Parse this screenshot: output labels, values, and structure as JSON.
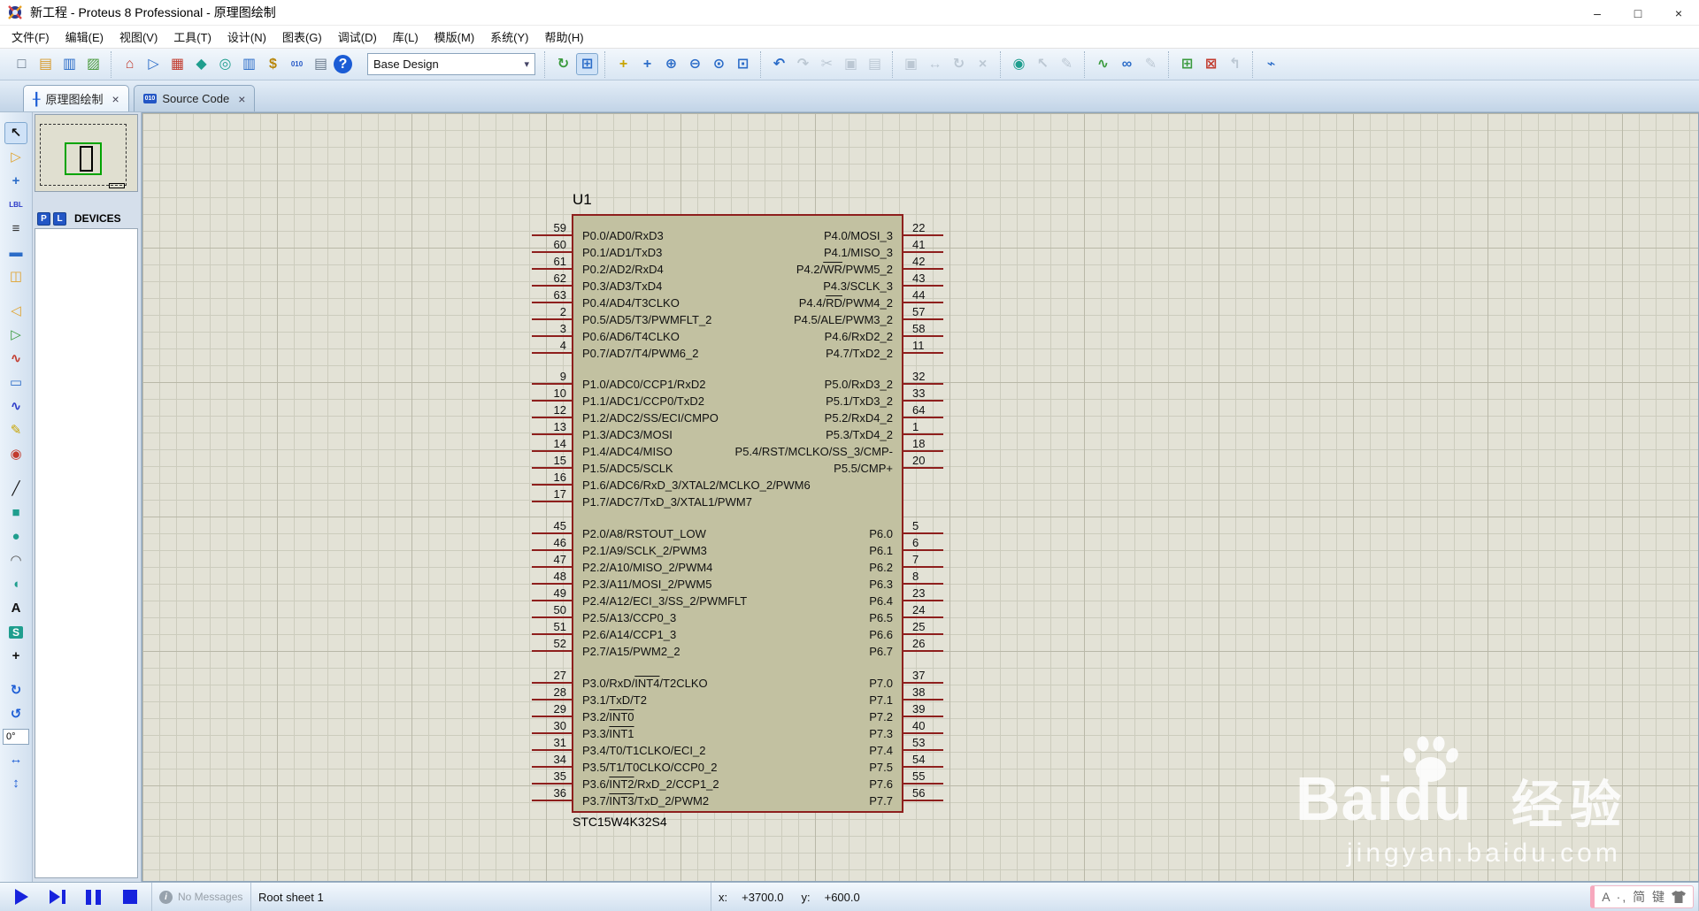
{
  "window": {
    "title": "新工程 - Proteus 8 Professional - 原理图绘制",
    "controls": [
      {
        "name": "minimize-button",
        "glyph": "–"
      },
      {
        "name": "maximize-button",
        "glyph": "□"
      },
      {
        "name": "close-button",
        "glyph": "×"
      }
    ]
  },
  "menu": {
    "items": [
      "文件(F)",
      "编辑(E)",
      "视图(V)",
      "工具(T)",
      "设计(N)",
      "图表(G)",
      "调试(D)",
      "库(L)",
      "模版(M)",
      "系统(Y)",
      "帮助(H)"
    ]
  },
  "toolbar": {
    "design_selector": {
      "value": "Base Design",
      "arrow": "▾"
    },
    "segments": [
      {
        "kind": "icons",
        "items": [
          {
            "n": "new-project-icon",
            "g": "□",
            "c": "#5a6b7d"
          },
          {
            "n": "open-project-icon",
            "g": "▤",
            "c": "#d79a2b"
          },
          {
            "n": "save-project-icon",
            "g": "▥",
            "c": "#2b6cc8"
          },
          {
            "n": "import-project-icon",
            "g": "▨",
            "c": "#4a9a3d"
          }
        ]
      },
      {
        "kind": "icons",
        "items": [
          {
            "n": "home-icon",
            "g": "⌂",
            "c": "#c23b2e"
          },
          {
            "n": "schematic-capture-icon",
            "g": "▷",
            "c": "#2b6cc8"
          },
          {
            "n": "pcb-layout-icon",
            "g": "▦",
            "c": "#c23b2e"
          },
          {
            "n": "3d-visualizer-icon",
            "g": "◆",
            "c": "#1f9e8e"
          },
          {
            "n": "gerber-viewer-icon",
            "g": "◎",
            "c": "#1f9e8e"
          },
          {
            "n": "design-explorer-icon",
            "g": "▥",
            "c": "#2b6cc8"
          },
          {
            "n": "bill-of-materials-icon",
            "g": "$",
            "c": "#b8860b"
          },
          {
            "n": "source-code-icon",
            "g": "010",
            "c": "#2356c5"
          },
          {
            "n": "project-notes-icon",
            "g": "▤",
            "c": "#6b7b8d"
          },
          {
            "n": "help-icon",
            "g": "?",
            "c": "#ffffff",
            "round": true
          }
        ]
      },
      {
        "kind": "select"
      },
      {
        "kind": "icons",
        "items": [
          {
            "n": "redraw-icon",
            "g": "↻",
            "c": "#3a9a3d"
          },
          {
            "n": "grid-toggle-icon",
            "g": "⊞",
            "c": "#2b6cc8",
            "pressed": true
          }
        ]
      },
      {
        "kind": "icons",
        "items": [
          {
            "n": "origin-icon",
            "g": "+",
            "c": "#c8a400"
          },
          {
            "n": "pan-icon",
            "g": "+",
            "c": "#2b6cc8"
          },
          {
            "n": "zoom-in-icon",
            "g": "⊕",
            "c": "#2b6cc8"
          },
          {
            "n": "zoom-out-icon",
            "g": "⊖",
            "c": "#2b6cc8"
          },
          {
            "n": "zoom-all-icon",
            "g": "⊙",
            "c": "#2b6cc8"
          },
          {
            "n": "zoom-area-icon",
            "g": "⊡",
            "c": "#2b6cc8"
          }
        ]
      },
      {
        "kind": "icons",
        "items": [
          {
            "n": "undo-icon",
            "g": "↶",
            "c": "#2b6cc8"
          },
          {
            "n": "redo-icon",
            "g": "↷",
            "c": "#8a99a8",
            "disabled": true
          },
          {
            "n": "cut-icon",
            "g": "✂",
            "c": "#8a99a8",
            "disabled": true
          },
          {
            "n": "copy-icon",
            "g": "▣",
            "c": "#8a99a8",
            "disabled": true
          },
          {
            "n": "paste-icon",
            "g": "▤",
            "c": "#8a99a8",
            "disabled": true
          }
        ]
      },
      {
        "kind": "icons",
        "items": [
          {
            "n": "block-copy-icon",
            "g": "▣",
            "c": "#8a99a8",
            "disabled": true
          },
          {
            "n": "block-move-icon",
            "g": "↔",
            "c": "#8a99a8",
            "disabled": true
          },
          {
            "n": "block-rotate-icon",
            "g": "↻",
            "c": "#8a99a8",
            "disabled": true
          },
          {
            "n": "block-delete-icon",
            "g": "×",
            "c": "#8a99a8",
            "disabled": true
          }
        ]
      },
      {
        "kind": "icons",
        "items": [
          {
            "n": "goto-sheet-icon",
            "g": "◉",
            "c": "#1f9e8e"
          },
          {
            "n": "cursor-add-icon",
            "g": "↖",
            "c": "#8a99a8",
            "disabled": true
          },
          {
            "n": "design-tools-icon",
            "g": "✎",
            "c": "#8a99a8",
            "disabled": true
          }
        ]
      },
      {
        "kind": "icons",
        "items": [
          {
            "n": "wire-autoroute-icon",
            "g": "∿",
            "c": "#3a9a3d"
          },
          {
            "n": "search-icon",
            "g": "∞",
            "c": "#2b6cc8"
          },
          {
            "n": "property-assignment-icon",
            "g": "✎",
            "c": "#8a99a8",
            "disabled": true
          }
        ]
      },
      {
        "kind": "icons",
        "items": [
          {
            "n": "new-sheet-icon",
            "g": "⊞",
            "c": "#3a9a3d"
          },
          {
            "n": "remove-sheet-icon",
            "g": "⊠",
            "c": "#c23b2e"
          },
          {
            "n": "parent-sheet-icon",
            "g": "↰",
            "c": "#8a99a8",
            "disabled": true
          }
        ]
      },
      {
        "kind": "icons",
        "items": [
          {
            "n": "erc-report-icon",
            "g": "⌁",
            "c": "#2b6cc8"
          }
        ]
      }
    ]
  },
  "tabs": [
    {
      "label": "原理图绘制",
      "icon": "schematic-tab-icon",
      "glyph": "╂",
      "close": "×",
      "active": true
    },
    {
      "label": "Source Code",
      "icon": "source-code-tab-icon",
      "glyph": "010",
      "close": "×",
      "active": false
    }
  ],
  "tool_strip": {
    "angle_value": "0°",
    "items": [
      {
        "n": "selection-tool-icon",
        "g": "↖",
        "c": "#111111",
        "selected": true
      },
      {
        "n": "component-mode-icon",
        "g": "▷",
        "c": "#e0a22c"
      },
      {
        "n": "junction-dot-icon",
        "g": "+",
        "c": "#2b6cc8"
      },
      {
        "n": "wire-label-icon",
        "g": "LBL",
        "c": "#2b3ac8"
      },
      {
        "n": "text-script-icon",
        "g": "≡",
        "c": "#333333"
      },
      {
        "n": "bus-icon",
        "g": "▬",
        "c": "#2b6cc8"
      },
      {
        "n": "subcircuit-icon",
        "g": "◫",
        "c": "#e0a22c"
      },
      {
        "kind": "sep"
      },
      {
        "n": "terminal-mode-icon",
        "g": "◁",
        "c": "#e0a22c"
      },
      {
        "n": "device-pin-icon",
        "g": "▷",
        "c": "#3a9a3d"
      },
      {
        "n": "graph-mode-icon",
        "g": "∿",
        "c": "#c23b2e"
      },
      {
        "n": "active-popup-icon",
        "g": "▭",
        "c": "#2b6cc8"
      },
      {
        "n": "generator-mode-icon",
        "g": "∿",
        "c": "#2b3ac8"
      },
      {
        "n": "voltage-probe-icon",
        "g": "✎",
        "c": "#c8a400"
      },
      {
        "n": "virtual-instruments-icon",
        "g": "◉",
        "c": "#c23b2e"
      },
      {
        "kind": "sep"
      },
      {
        "n": "line-2d-icon",
        "g": "╱",
        "c": "#111111"
      },
      {
        "n": "box-2d-icon",
        "g": "■",
        "c": "#1f9e8e"
      },
      {
        "n": "circle-2d-icon",
        "g": "●",
        "c": "#1f9e8e"
      },
      {
        "n": "arc-2d-icon",
        "g": "◠",
        "c": "#555555"
      },
      {
        "n": "path-2d-icon",
        "g": "◖",
        "c": "#1f9e8e"
      },
      {
        "n": "text-2d-icon",
        "g": "A",
        "c": "#111111"
      },
      {
        "n": "symbol-2d-icon",
        "g": "S",
        "c": "#ffffff",
        "boxed": true
      },
      {
        "n": "marker-2d-icon",
        "g": "+",
        "c": "#111111"
      },
      {
        "kind": "sep"
      },
      {
        "n": "rotate-cw-icon",
        "g": "↻",
        "c": "#1b5cd5"
      },
      {
        "n": "rotate-ccw-icon",
        "g": "↺",
        "c": "#1b5cd5"
      },
      {
        "kind": "angle",
        "n": "rotation-angle-input"
      },
      {
        "n": "flip-horizontal-icon",
        "g": "↔",
        "c": "#1b5cd5"
      },
      {
        "n": "flip-vertical-icon",
        "g": "↕",
        "c": "#1b5cd5"
      }
    ]
  },
  "devices_panel": {
    "pick_label": "P",
    "library_label": "L",
    "title": "DEVICES"
  },
  "chip": {
    "ref": "U1",
    "part": "STC15W4K32S4",
    "left_groups": [
      {
        "rows": [
          {
            "n": "59",
            "l": "P0.0/AD0/RxD3"
          },
          {
            "n": "60",
            "l": "P0.1/AD1/TxD3"
          },
          {
            "n": "61",
            "l": "P0.2/AD2/RxD4"
          },
          {
            "n": "62",
            "l": "P0.3/AD3/TxD4"
          },
          {
            "n": "63",
            "l": "P0.4/AD4/T3CLKO"
          },
          {
            "n": "2",
            "l": "P0.5/AD5/T3/PWMFLT_2"
          },
          {
            "n": "3",
            "l": "P0.6/AD6/T4CLKO"
          },
          {
            "n": "4",
            "l": "P0.7/AD7/T4/PWM6_2"
          }
        ]
      },
      {
        "rows": [
          {
            "n": "9",
            "l": "P1.0/ADC0/CCP1/RxD2"
          },
          {
            "n": "10",
            "l": "P1.1/ADC1/CCP0/TxD2"
          },
          {
            "n": "12",
            "l": "P1.2/ADC2/SS/ECI/CMPO"
          },
          {
            "n": "13",
            "l": "P1.3/ADC3/MOSI"
          },
          {
            "n": "14",
            "l": "P1.4/ADC4/MISO"
          },
          {
            "n": "15",
            "l": "P1.5/ADC5/SCLK"
          },
          {
            "n": "16",
            "l": "P1.6/ADC6/RxD_3/XTAL2/MCLKO_2/PWM6"
          },
          {
            "n": "17",
            "l": "P1.7/ADC7/TxD_3/XTAL1/PWM7"
          }
        ]
      },
      {
        "rows": [
          {
            "n": "45",
            "l": "P2.0/A8/RSTOUT_LOW"
          },
          {
            "n": "46",
            "l": "P2.1/A9/SCLK_2/PWM3"
          },
          {
            "n": "47",
            "l": "P2.2/A10/MISO_2/PWM4"
          },
          {
            "n": "48",
            "l": "P2.3/A11/MOSI_2/PWM5"
          },
          {
            "n": "49",
            "l": "P2.4/A12/ECI_3/SS_2/PWMFLT"
          },
          {
            "n": "50",
            "l": "P2.5/A13/CCP0_3"
          },
          {
            "n": "51",
            "l": "P2.6/A14/CCP1_3"
          },
          {
            "n": "52",
            "l": "P2.7/A15/PWM2_2"
          }
        ]
      },
      {
        "rows": [
          {
            "n": "27",
            "l": [
              "P3.0/RxD/",
              [
                "INT4"
              ],
              "/T2CLKO"
            ]
          },
          {
            "n": "28",
            "l": "P3.1/TxD/T2"
          },
          {
            "n": "29",
            "l": [
              "P3.2/",
              [
                "INT0"
              ]
            ]
          },
          {
            "n": "30",
            "l": [
              "P3.3/",
              [
                "INT1"
              ]
            ]
          },
          {
            "n": "31",
            "l": "P3.4/T0/T1CLKO/ECI_2"
          },
          {
            "n": "34",
            "l": "P3.5/T1/T0CLKO/CCP0_2"
          },
          {
            "n": "35",
            "l": [
              "P3.6/",
              [
                "INT2"
              ],
              "/RxD_2/CCP1_2"
            ]
          },
          {
            "n": "36",
            "l": [
              "P3.7/",
              [
                "INT3"
              ],
              "/TxD_2/PWM2"
            ]
          }
        ]
      }
    ],
    "right_groups": [
      {
        "rows": [
          {
            "n": "22",
            "l": "P4.0/MOSI_3"
          },
          {
            "n": "41",
            "l": "P4.1/MISO_3"
          },
          {
            "n": "42",
            "l": [
              "P4.2/",
              [
                "WR"
              ],
              "/PWM5_2"
            ]
          },
          {
            "n": "43",
            "l": "P4.3/SCLK_3"
          },
          {
            "n": "44",
            "l": [
              "P4.4/",
              [
                "RD"
              ],
              "/PWM4_2"
            ]
          },
          {
            "n": "57",
            "l": "P4.5/ALE/PWM3_2"
          },
          {
            "n": "58",
            "l": "P4.6/RxD2_2"
          },
          {
            "n": "11",
            "l": "P4.7/TxD2_2"
          }
        ]
      },
      {
        "rows": [
          {
            "n": "32",
            "l": "P5.0/RxD3_2"
          },
          {
            "n": "33",
            "l": "P5.1/TxD3_2"
          },
          {
            "n": "64",
            "l": "P5.2/RxD4_2"
          },
          {
            "n": "1",
            "l": "P5.3/TxD4_2"
          },
          {
            "n": "18",
            "l": "P5.4/RST/MCLKO/SS_3/CMP-"
          },
          {
            "n": "20",
            "l": "P5.5/CMP+"
          }
        ]
      },
      {
        "rows": [
          {
            "n": "5",
            "l": "P6.0"
          },
          {
            "n": "6",
            "l": "P6.1"
          },
          {
            "n": "7",
            "l": "P6.2"
          },
          {
            "n": "8",
            "l": "P6.3"
          },
          {
            "n": "23",
            "l": "P6.4"
          },
          {
            "n": "24",
            "l": "P6.5"
          },
          {
            "n": "25",
            "l": "P6.6"
          },
          {
            "n": "26",
            "l": "P6.7"
          }
        ]
      },
      {
        "rows": [
          {
            "n": "37",
            "l": "P7.0"
          },
          {
            "n": "38",
            "l": "P7.1"
          },
          {
            "n": "39",
            "l": "P7.2"
          },
          {
            "n": "40",
            "l": "P7.3"
          },
          {
            "n": "53",
            "l": "P7.4"
          },
          {
            "n": "54",
            "l": "P7.5"
          },
          {
            "n": "55",
            "l": "P7.6"
          },
          {
            "n": "56",
            "l": "P7.7"
          }
        ]
      }
    ]
  },
  "status_bar": {
    "messages": "No Messages",
    "sheet": "Root sheet 1",
    "coordinates": {
      "x_label": "x:",
      "x_value": "+3700.0",
      "y_label": "y:",
      "y_value": "+600.0"
    }
  },
  "ime": {
    "text": "A ·, 简 键"
  },
  "watermark": {
    "brand": "Baidu",
    "suffix": "经验",
    "url": "jingyan.baidu.com"
  },
  "colors": {
    "chip_fill": "#c2c1a1",
    "chip_border": "#8e1f1d",
    "grid_bg": "#e3e2d6",
    "grid_line": "#ccccbd",
    "accent_blue": "#2356c5",
    "play_blue": "#1723dd"
  }
}
